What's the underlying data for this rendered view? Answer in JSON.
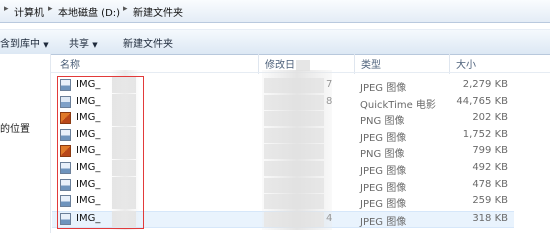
{
  "address": {
    "path": [
      "计算机",
      "本地磁盘 (D:)",
      "新建文件夹"
    ]
  },
  "toolbar": {
    "include_label": "含到库中",
    "share_label": "共享",
    "new_folder_label": "新建文件夹"
  },
  "nav": {
    "partial_label": "的位置"
  },
  "columns": {
    "name": "名称",
    "modified": "修改日",
    "type": "类型",
    "size": "大小"
  },
  "files": [
    {
      "name": "IMG_",
      "date_tail": "7",
      "type": "JPEG 图像",
      "size": "2,279 KB",
      "icon": "jpeg-file-icon"
    },
    {
      "name": "IMG_",
      "date_tail": "8",
      "type": "QuickTime 电影",
      "size": "44,765 KB",
      "icon": "quicktime-file-icon"
    },
    {
      "name": "IMG_",
      "date_tail": "",
      "type": "PNG 图像",
      "size": "202 KB",
      "icon": "png-file-icon"
    },
    {
      "name": "IMG_",
      "date_tail": "",
      "type": "JPEG 图像",
      "size": "1,752 KB",
      "icon": "jpeg-file-icon"
    },
    {
      "name": "IMG_",
      "date_tail": "",
      "type": "PNG 图像",
      "size": "799 KB",
      "icon": "png-file-icon"
    },
    {
      "name": "IMG_",
      "date_tail": "",
      "type": "JPEG 图像",
      "size": "492 KB",
      "icon": "jpeg-file-icon"
    },
    {
      "name": "IMG_",
      "date_tail": "",
      "type": "JPEG 图像",
      "size": "478 KB",
      "icon": "jpeg-file-icon"
    },
    {
      "name": "IMG_",
      "date_tail": "",
      "type": "JPEG 图像",
      "size": "259 KB",
      "icon": "jpeg-file-icon"
    },
    {
      "name": "IMG_",
      "date_tail": "4",
      "type": "JPEG 图像",
      "size": "318 KB",
      "icon": "jpeg-file-icon",
      "selected": true
    }
  ],
  "colors": {
    "annotation": "#e23a3a",
    "selection": "#e9f3fd"
  }
}
